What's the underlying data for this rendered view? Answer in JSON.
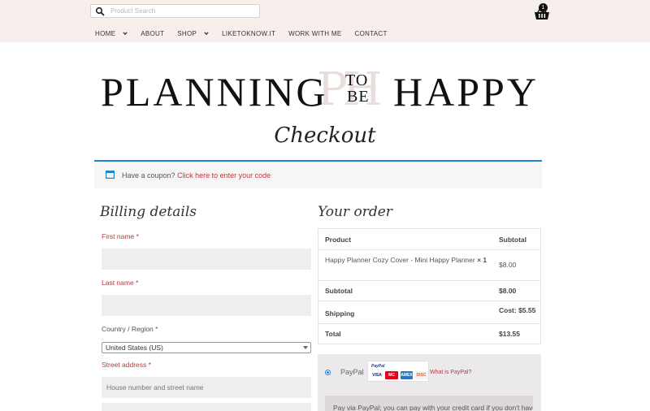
{
  "search": {
    "placeholder": "Product Search"
  },
  "cart": {
    "count": "1"
  },
  "nav": {
    "items": [
      {
        "label": "HOME"
      },
      {
        "label": "ABOUT"
      },
      {
        "label": "SHOP"
      },
      {
        "label": "LIKETOKNOW.IT"
      },
      {
        "label": "WORK WITH ME"
      },
      {
        "label": "CONTACT"
      }
    ]
  },
  "logo": {
    "left": "PLANNING",
    "to": "TO",
    "be": "BE",
    "right": "HAPPY",
    "monogram": "PH"
  },
  "page_title": "Checkout",
  "coupon": {
    "text": "Have a coupon?",
    "link": "Click here to enter your code"
  },
  "billing": {
    "heading": "Billing details",
    "first_name_label": "First name",
    "last_name_label": "Last name",
    "country_label": "Country / Region",
    "country_value": "United States (US)",
    "street_label": "Street address",
    "street_placeholder": "House number and street name",
    "required_mark": "*"
  },
  "order": {
    "heading": "Your order",
    "col_product": "Product",
    "col_subtotal": "Subtotal",
    "item_name": "Happy Planner Cozy Cover - Mini Happy Planner",
    "item_qty": "× 1",
    "item_price": "$8.00",
    "subtotal_label": "Subtotal",
    "subtotal_value": "$8.00",
    "shipping_label": "Shipping",
    "shipping_value": "Cost: $5.55",
    "total_label": "Total",
    "total_value": "$13.55"
  },
  "payment": {
    "method_label": "PayPal",
    "cards_header": "PayPal",
    "card_logos": [
      "VISA",
      "MC",
      "AMEX",
      "DISC"
    ],
    "what_link": "What is PayPal?",
    "description": "Pay via PayPal; you can pay with your credit card if you don't have a"
  },
  "colors": {
    "topbar": "#f7efec",
    "link": "#b5393f",
    "accent": "#1e85be"
  }
}
